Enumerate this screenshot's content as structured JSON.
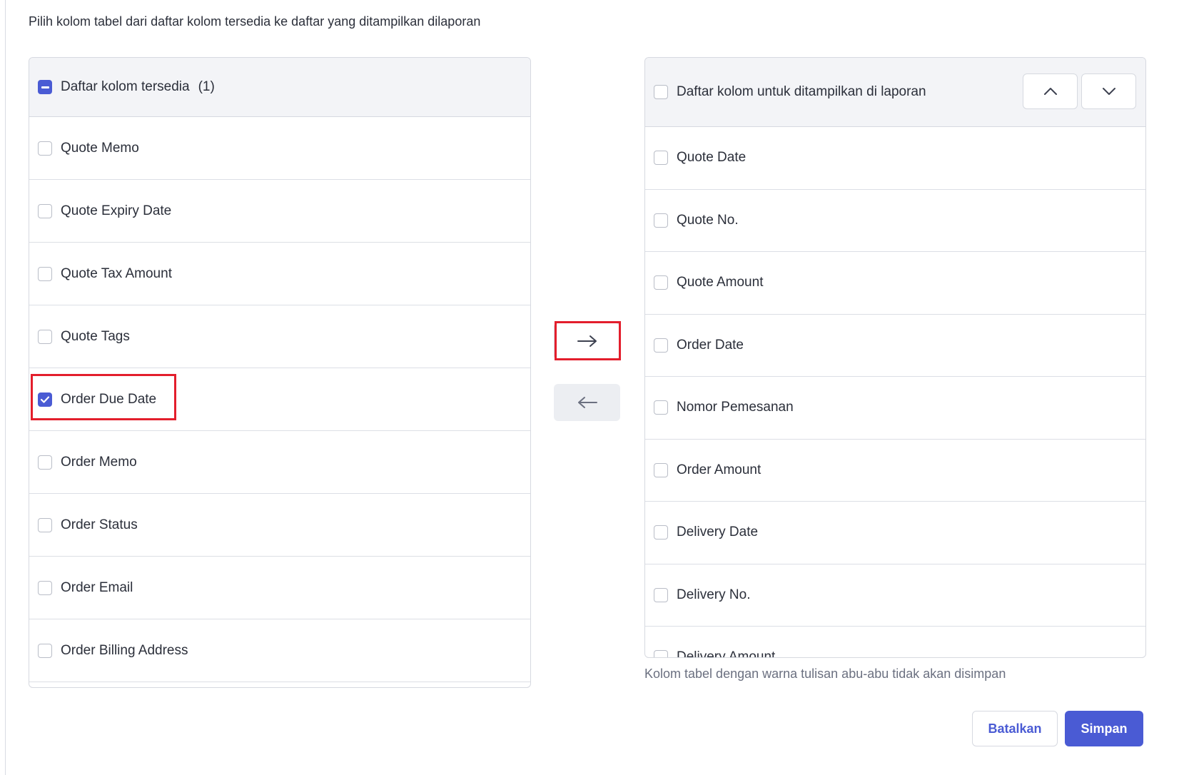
{
  "instruction": "Pilih kolom tabel dari daftar kolom tersedia ke daftar yang ditampilkan dilaporan",
  "available": {
    "header_label": "Daftar kolom tersedia",
    "header_count": "(1)",
    "items": [
      {
        "label": "Quote Memo",
        "checked": false
      },
      {
        "label": "Quote Expiry Date",
        "checked": false
      },
      {
        "label": "Quote Tax Amount",
        "checked": false
      },
      {
        "label": "Quote Tags",
        "checked": false
      },
      {
        "label": "Order Due Date",
        "checked": true
      },
      {
        "label": "Order Memo",
        "checked": false
      },
      {
        "label": "Order Status",
        "checked": false
      },
      {
        "label": "Order Email",
        "checked": false
      },
      {
        "label": "Order Billing Address",
        "checked": false
      }
    ]
  },
  "selected": {
    "header_label": "Daftar kolom untuk ditampilkan di laporan",
    "items": [
      {
        "label": "Quote Date",
        "checked": false
      },
      {
        "label": "Quote No.",
        "checked": false
      },
      {
        "label": "Quote Amount",
        "checked": false
      },
      {
        "label": "Order Date",
        "checked": false
      },
      {
        "label": "Nomor Pemesanan",
        "checked": false
      },
      {
        "label": "Order Amount",
        "checked": false
      },
      {
        "label": "Delivery Date",
        "checked": false
      },
      {
        "label": "Delivery No.",
        "checked": false
      },
      {
        "label": "Delivery Amount",
        "checked": false
      }
    ]
  },
  "note": "Kolom tabel dengan warna tulisan abu-abu tidak akan disimpan",
  "buttons": {
    "cancel": "Batalkan",
    "save": "Simpan"
  },
  "icons": {
    "move_right": "arrow-right-icon",
    "move_left": "arrow-left-icon",
    "move_up": "chevron-up-icon",
    "move_down": "chevron-down-icon"
  },
  "colors": {
    "accent": "#4a5bd4",
    "highlight": "#e31e2c"
  }
}
